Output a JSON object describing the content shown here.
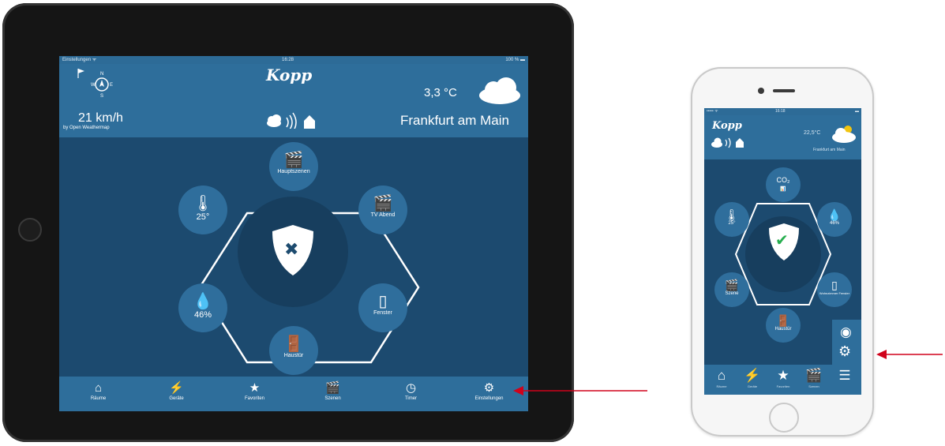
{
  "colors": {
    "accent": "#2e6e9b",
    "background": "#1c4a6f",
    "node": "#2f6e9c",
    "arrow": "#d0021b",
    "check": "#27ae4f"
  },
  "tablet": {
    "status": {
      "left": "Einstellungen ᯤ",
      "center": "16:28",
      "right": "100 % ▬"
    },
    "header": {
      "logo": "Kopp",
      "wind_speed": "21 km/h",
      "wind_source": "by Open Weathermap",
      "compass": {
        "n": "N",
        "e": "E",
        "s": "S",
        "w": "W"
      },
      "temperature": "3,3 °C",
      "city": "Frankfurt am Main"
    },
    "hub": {
      "nodes": [
        {
          "icon": "clapperboard-icon",
          "glyph": "🎬",
          "label": "Hauptszenen"
        },
        {
          "icon": "clapperboard-icon",
          "glyph": "🎬",
          "label": "TV Abend"
        },
        {
          "icon": "window-icon",
          "glyph": "▯",
          "label": "Fenster"
        },
        {
          "icon": "door-icon",
          "glyph": "🚪",
          "label": "Haustür"
        },
        {
          "icon": "humidity-icon",
          "glyph": "💧",
          "label": "46%"
        },
        {
          "icon": "thermometer-icon",
          "glyph": "🌡",
          "label": "25°"
        }
      ],
      "center_glyph": "✖"
    },
    "nav": [
      {
        "icon": "home-icon",
        "glyph": "⌂",
        "label": "Räume"
      },
      {
        "icon": "devices-icon",
        "glyph": "⚡",
        "label": "Geräte"
      },
      {
        "icon": "star-icon",
        "glyph": "★",
        "label": "Favoriten"
      },
      {
        "icon": "scenes-icon",
        "glyph": "🎬",
        "label": "Szenen"
      },
      {
        "icon": "clock-icon",
        "glyph": "◷",
        "label": "Timer"
      },
      {
        "icon": "settings-icon",
        "glyph": "⚙",
        "label": "Einstellungen"
      }
    ]
  },
  "phone": {
    "status": {
      "left": "••••• ᯤ",
      "center": "16:18",
      "right": "▬"
    },
    "header": {
      "logo": "Kopp",
      "temperature": "22,5°C",
      "city": "Frankfurt am Main"
    },
    "hub": {
      "nodes": [
        {
          "icon": "co2-icon",
          "glyph": "CO₂",
          "label": "📊"
        },
        {
          "icon": "humidity-icon",
          "glyph": "💧",
          "label": "46%"
        },
        {
          "icon": "window-icon",
          "glyph": "▯",
          "label": "Wohnzimmer Fenster"
        },
        {
          "icon": "door-icon",
          "glyph": "🚪",
          "label": "Haustür"
        },
        {
          "icon": "clapperboard-icon",
          "glyph": "🎬",
          "label": "Szene"
        },
        {
          "icon": "thermometer-icon",
          "glyph": "🌡",
          "label": "25°"
        }
      ],
      "center_glyph": "✔"
    },
    "side": [
      {
        "icon": "palette-icon",
        "glyph": "◉"
      },
      {
        "icon": "settings-icon",
        "glyph": "⚙"
      }
    ],
    "nav": [
      {
        "icon": "home-icon",
        "glyph": "⌂",
        "label": "Räume"
      },
      {
        "icon": "devices-icon",
        "glyph": "⚡",
        "label": "Geräte"
      },
      {
        "icon": "star-icon",
        "glyph": "★",
        "label": "Favoriten"
      },
      {
        "icon": "scenes-icon",
        "glyph": "🎬",
        "label": "Szenen"
      },
      {
        "icon": "menu-icon",
        "glyph": "☰",
        "label": ""
      }
    ]
  }
}
